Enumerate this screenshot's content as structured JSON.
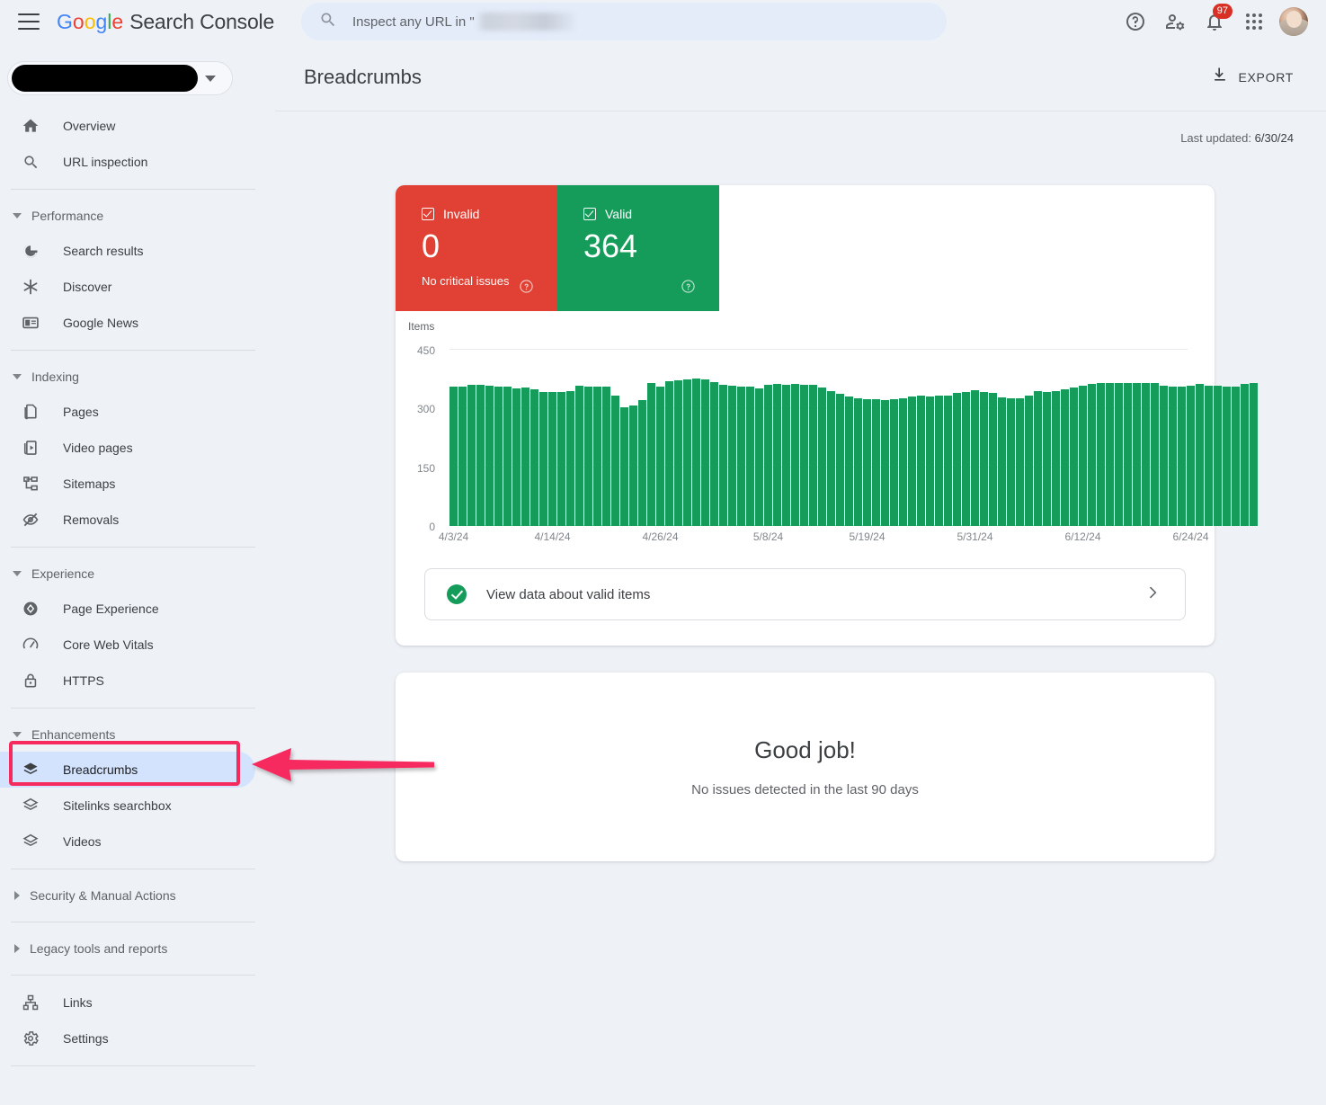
{
  "topbar": {
    "menu_icon": "hamburger-menu-icon",
    "brand_google": "Google",
    "brand_product": "Search Console",
    "search": {
      "icon": "search-icon",
      "prefix_text": "Inspect any URL in \"",
      "redacted": true
    },
    "icons": {
      "help": "help-icon",
      "account_settings": "account-settings-icon",
      "notifications": "bell-icon",
      "notifications_count": "97",
      "apps": "apps-grid-icon",
      "avatar": "user-avatar"
    }
  },
  "sidebar": {
    "property_selector": {
      "label_redacted": true,
      "caret": "chevron-down-icon"
    },
    "items": [
      {
        "label": "Overview",
        "icon": "home-icon",
        "type": "item"
      },
      {
        "label": "URL inspection",
        "icon": "search-icon",
        "type": "item"
      },
      {
        "label": "Performance",
        "icon": "chevron-down-icon",
        "type": "group-open"
      },
      {
        "label": "Search results",
        "icon": "google-g-icon",
        "type": "item"
      },
      {
        "label": "Discover",
        "icon": "discover-asterisk-icon",
        "type": "item"
      },
      {
        "label": "Google News",
        "icon": "news-icon",
        "type": "item"
      },
      {
        "label": "Indexing",
        "icon": "chevron-down-icon",
        "type": "group-open"
      },
      {
        "label": "Pages",
        "icon": "pages-icon",
        "type": "item"
      },
      {
        "label": "Video pages",
        "icon": "video-pages-icon",
        "type": "item"
      },
      {
        "label": "Sitemaps",
        "icon": "sitemaps-icon",
        "type": "item"
      },
      {
        "label": "Removals",
        "icon": "eye-off-icon",
        "type": "item"
      },
      {
        "label": "Experience",
        "icon": "chevron-down-icon",
        "type": "group-open"
      },
      {
        "label": "Page Experience",
        "icon": "page-experience-icon",
        "type": "item"
      },
      {
        "label": "Core Web Vitals",
        "icon": "speedometer-icon",
        "type": "item"
      },
      {
        "label": "HTTPS",
        "icon": "lock-icon",
        "type": "item"
      },
      {
        "label": "Enhancements",
        "icon": "chevron-down-icon",
        "type": "group-open"
      },
      {
        "label": "Breadcrumbs",
        "icon": "layers-icon",
        "type": "item",
        "active": true
      },
      {
        "label": "Sitelinks searchbox",
        "icon": "layers-icon",
        "type": "item"
      },
      {
        "label": "Videos",
        "icon": "layers-icon",
        "type": "item"
      },
      {
        "label": "Security & Manual Actions",
        "icon": "chevron-right-icon",
        "type": "group-closed"
      },
      {
        "label": "Legacy tools and reports",
        "icon": "chevron-right-icon",
        "type": "group-closed"
      },
      {
        "label": "Links",
        "icon": "links-icon",
        "type": "item"
      },
      {
        "label": "Settings",
        "icon": "gear-icon",
        "type": "item"
      }
    ]
  },
  "annotation": {
    "highlight_color": "#f72a5e",
    "arrow_color": "#f72a5e",
    "target": "Breadcrumbs"
  },
  "main": {
    "page_title": "Breadcrumbs",
    "export_label": "EXPORT",
    "export_icon": "download-icon",
    "last_updated_label": "Last updated:",
    "last_updated_value": "6/30/24",
    "status_cards": [
      {
        "label": "Invalid",
        "count": "0",
        "sublabel": "No critical issues",
        "color": "#e04134",
        "help_icon": "help-circle-icon"
      },
      {
        "label": "Valid",
        "count": "364",
        "sublabel": "",
        "color": "#169c5a",
        "help_icon": "help-circle-icon"
      }
    ],
    "view_data_row": {
      "label": "View data about valid items",
      "status_icon": "check-circle-icon",
      "chevron": "chevron-right-icon"
    },
    "good_job": {
      "title": "Good job!",
      "subtitle": "No issues detected in the last 90 days"
    }
  },
  "chart_data": {
    "type": "bar",
    "title": "",
    "xlabel": "",
    "ylabel": "Items",
    "ylim": [
      0,
      450
    ],
    "yticks": [
      0,
      150,
      300,
      450
    ],
    "grid": true,
    "legend": false,
    "series_color": "#169c5a",
    "tick_labels": [
      "4/3/24",
      "4/14/24",
      "4/26/24",
      "5/8/24",
      "5/19/24",
      "5/31/24",
      "6/12/24",
      "6/24/24"
    ],
    "tick_indices": [
      0,
      11,
      23,
      35,
      46,
      58,
      70,
      82
    ],
    "x": [
      "4/3/24",
      "4/4/24",
      "4/5/24",
      "4/6/24",
      "4/7/24",
      "4/8/24",
      "4/9/24",
      "4/10/24",
      "4/11/24",
      "4/12/24",
      "4/13/24",
      "4/14/24",
      "4/15/24",
      "4/16/24",
      "4/17/24",
      "4/18/24",
      "4/19/24",
      "4/20/24",
      "4/21/24",
      "4/22/24",
      "4/23/24",
      "4/24/24",
      "4/25/24",
      "4/26/24",
      "4/27/24",
      "4/28/24",
      "4/29/24",
      "4/30/24",
      "5/1/24",
      "5/2/24",
      "5/3/24",
      "5/4/24",
      "5/5/24",
      "5/6/24",
      "5/7/24",
      "5/8/24",
      "5/9/24",
      "5/10/24",
      "5/11/24",
      "5/12/24",
      "5/13/24",
      "5/14/24",
      "5/15/24",
      "5/16/24",
      "5/17/24",
      "5/18/24",
      "5/19/24",
      "5/20/24",
      "5/21/24",
      "5/22/24",
      "5/23/24",
      "5/24/24",
      "5/25/24",
      "5/26/24",
      "5/27/24",
      "5/28/24",
      "5/29/24",
      "5/30/24",
      "5/31/24",
      "6/1/24",
      "6/2/24",
      "6/3/24",
      "6/4/24",
      "6/5/24",
      "6/6/24",
      "6/7/24",
      "6/8/24",
      "6/9/24",
      "6/10/24",
      "6/11/24",
      "6/12/24",
      "6/13/24",
      "6/14/24",
      "6/15/24",
      "6/16/24",
      "6/17/24",
      "6/18/24",
      "6/19/24",
      "6/20/24",
      "6/21/24",
      "6/22/24",
      "6/23/24",
      "6/24/24",
      "6/25/24",
      "6/26/24",
      "6/27/24",
      "6/28/24",
      "6/29/24"
    ],
    "values": [
      355,
      356,
      360,
      360,
      358,
      357,
      357,
      351,
      353,
      350,
      342,
      341,
      342,
      345,
      359,
      357,
      355,
      355,
      334,
      302,
      308,
      322,
      364,
      356,
      370,
      372,
      374,
      377,
      374,
      367,
      361,
      359,
      355,
      356,
      352,
      361,
      362,
      361,
      362,
      361,
      361,
      354,
      344,
      337,
      330,
      326,
      324,
      324,
      322,
      324,
      327,
      330,
      332,
      330,
      333,
      334,
      339,
      343,
      346,
      343,
      339,
      328,
      325,
      325,
      332,
      344,
      343,
      344,
      348,
      354,
      358,
      362,
      366,
      366,
      365,
      365,
      366,
      365,
      365,
      358,
      355,
      356,
      358,
      362,
      358,
      358,
      357,
      356,
      362,
      364
    ]
  }
}
